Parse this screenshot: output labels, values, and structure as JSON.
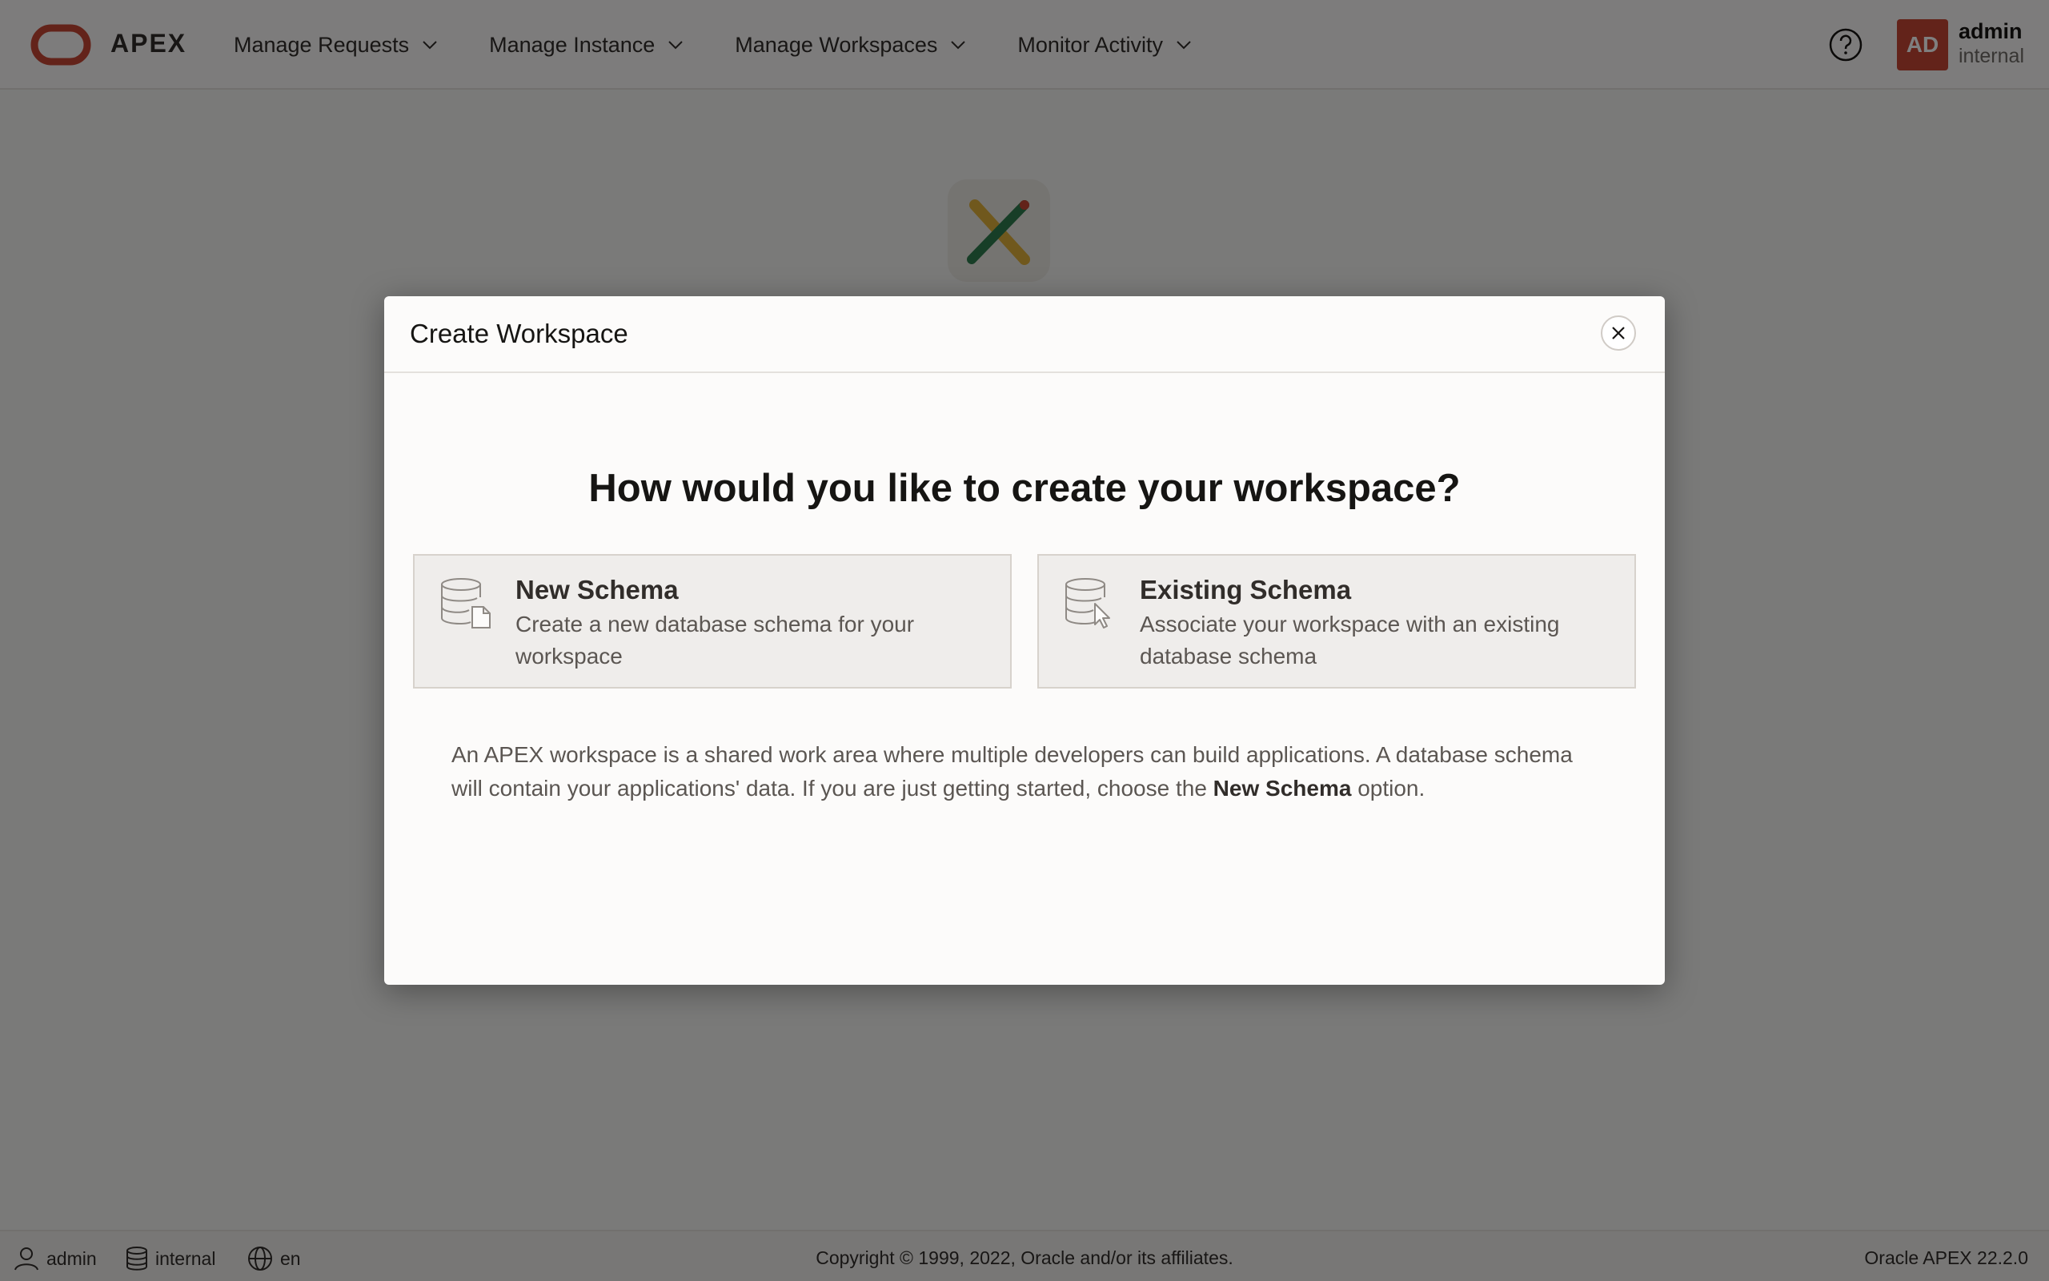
{
  "header": {
    "brand": "APEX",
    "nav": [
      {
        "label": "Manage Requests"
      },
      {
        "label": "Manage Instance"
      },
      {
        "label": "Manage Workspaces"
      },
      {
        "label": "Monitor Activity"
      }
    ],
    "user": {
      "initials": "AD",
      "name": "admin",
      "workspace": "internal"
    }
  },
  "dialog": {
    "title": "Create Workspace",
    "question": "How would you like to create your workspace?",
    "options": [
      {
        "title": "New Schema",
        "description": "Create a new database schema for your workspace"
      },
      {
        "title": "Existing Schema",
        "description": "Associate your workspace with an existing database schema"
      }
    ],
    "info_before": "An APEX workspace is a shared work area where multiple developers can build applications. A database schema will contain your applications' data. If you are just getting started, choose the ",
    "info_bold": "New Schema",
    "info_after": " option."
  },
  "footer": {
    "user": "admin",
    "workspace": "internal",
    "language": "en",
    "copyright": "Copyright © 1999, 2022, Oracle and/or its affiliates.",
    "version": "Oracle APEX 22.2.0"
  },
  "colors": {
    "brand_red": "#c74634",
    "overlay": "rgba(0,0,0,0.5)"
  }
}
